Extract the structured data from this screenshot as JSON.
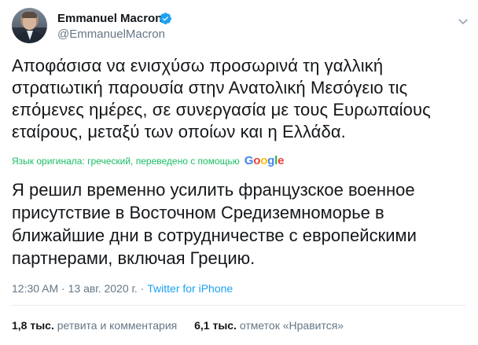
{
  "author": {
    "display_name": "Emmanuel Macron",
    "handle": "@EmmanuelMacron",
    "verified_icon": "verified-badge-icon",
    "avatar": "profile-photo"
  },
  "tweet": {
    "original_lines": [
      "Αποφάσισα να ενισχύσω προσωρινά τη γαλλική",
      "στρατιωτική παρουσία στην Ανατολική Μεσόγειο τις",
      "επόμενες ημέρες, σε συνεργασία με τους Ευρωπαίους",
      "εταίρους, μεταξύ των οποίων και η Ελλάδα."
    ],
    "translation_note": "Язык оригинала: греческий, переведено с помощью",
    "translation_provider": "Google",
    "translated_lines": [
      "Я решил временно усилить французское военное",
      "присутствие в Восточном Средиземноморье в",
      "ближайшие дни в сотрудничестве с европейскими",
      "партнерами, включая Грецию."
    ]
  },
  "meta": {
    "time": "12:30 AM",
    "date": "13 авг. 2020 г.",
    "separator": "·",
    "source": "Twitter for iPhone"
  },
  "stats": {
    "retweets_count": "1,8 тыс.",
    "retweets_label": "ретвита и комментария",
    "likes_count": "6,1 тыс.",
    "likes_label": "отметок «Нравится»"
  },
  "colors": {
    "text": "#14171a",
    "secondary": "#657786",
    "link": "#1da1f2",
    "translation": "#17bf63",
    "verified": "#1da1f2"
  }
}
